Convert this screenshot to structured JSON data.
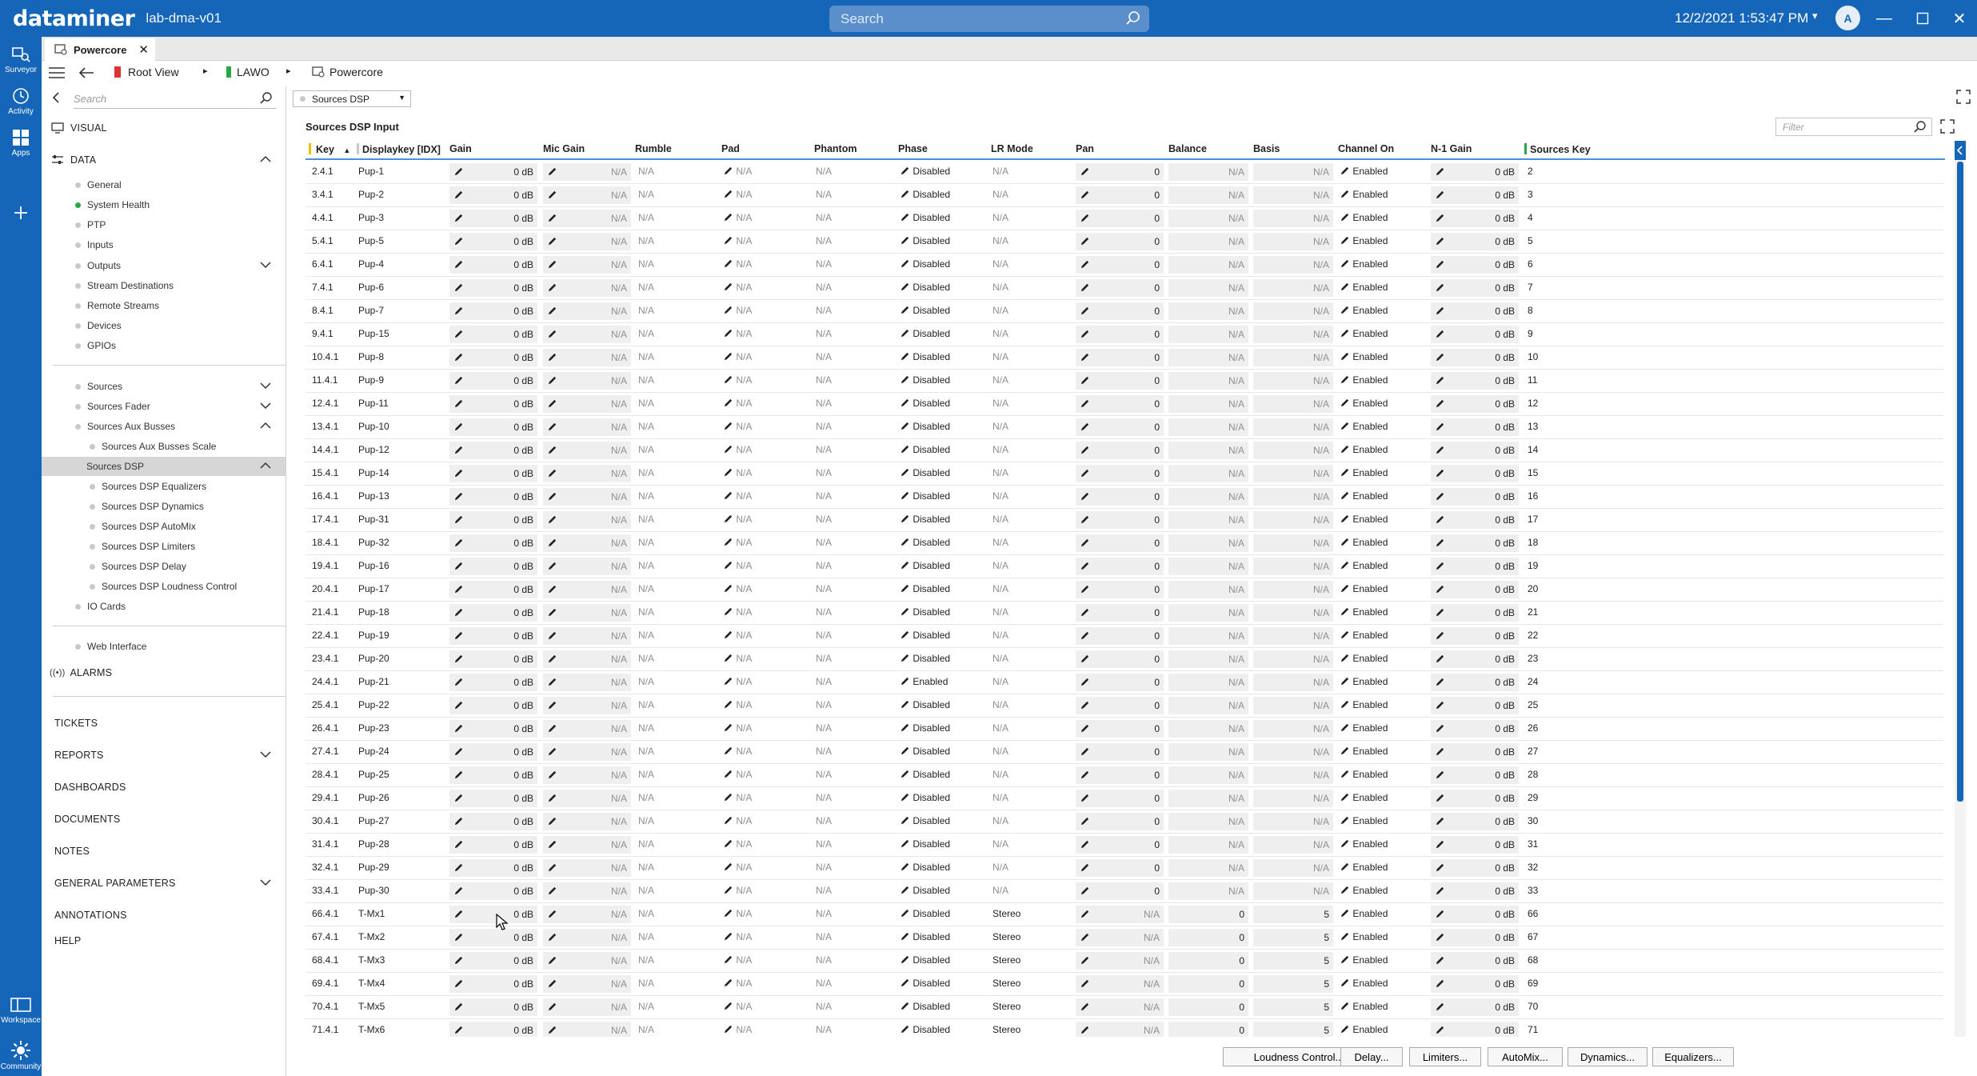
{
  "app": {
    "brand": "dataminer",
    "host": "lab-dma-v01",
    "search_placeholder": "Search",
    "datetime": "12/2/2021 1:53:47 PM",
    "avatar_letter": "A",
    "accent_color": "#1565b8"
  },
  "rail": {
    "surveyor": "Surveyor",
    "activity": "Activity",
    "apps": "Apps",
    "workspace": "Workspace",
    "community": "Community"
  },
  "tab": {
    "label": "Powercore"
  },
  "breadcrumb": {
    "root": "Root View",
    "element": "LAWO",
    "current": "Powercore"
  },
  "sidebar": {
    "search_placeholder": "Search",
    "visual": "VISUAL",
    "data": "DATA",
    "general": "General",
    "system_health": "System Health",
    "ptp": "PTP",
    "inputs": "Inputs",
    "outputs": "Outputs",
    "stream_destinations": "Stream Destinations",
    "remote_streams": "Remote Streams",
    "devices": "Devices",
    "gpios": "GPIOs",
    "sources": "Sources",
    "sources_fader": "Sources Fader",
    "sources_aux_busses": "Sources Aux Busses",
    "sources_aux_busses_scale": "Sources Aux Busses Scale",
    "sources_dsp": "Sources DSP",
    "sources_dsp_equalizers": "Sources DSP Equalizers",
    "sources_dsp_dynamics": "Sources DSP Dynamics",
    "sources_dsp_automix": "Sources DSP AutoMix",
    "sources_dsp_limiters": "Sources DSP Limiters",
    "sources_dsp_delay": "Sources DSP Delay",
    "sources_dsp_loudness": "Sources DSP Loudness Control",
    "io_cards": "IO Cards",
    "web_interface": "Web Interface",
    "alarms": "ALARMS",
    "tickets": "TICKETS",
    "reports": "REPORTS",
    "dashboards": "DASHBOARDS",
    "documents": "DOCUMENTS",
    "notes": "NOTES",
    "general_parameters": "GENERAL PARAMETERS",
    "annotations": "ANNOTATIONS",
    "help": "HELP"
  },
  "main": {
    "dropdown_value": "Sources DSP",
    "table_title": "Sources DSP Input",
    "filter_placeholder": "Filter",
    "columns": [
      "Key",
      "Displaykey [IDX]",
      "Gain",
      "Mic Gain",
      "Rumble",
      "Pad",
      "Phantom",
      "Phase",
      "LR Mode",
      "Pan",
      "Balance",
      "Basis",
      "Channel On",
      "N-1 Gain",
      "Sources Key"
    ],
    "rows": [
      {
        "key": "2.4.1",
        "display": "Pup-1",
        "gain": "0 dB",
        "mic": "N/A",
        "rumble": "N/A",
        "pad": "N/A",
        "phantom": "N/A",
        "phase": "Disabled",
        "lr": "N/A",
        "pan": "0",
        "balance": "N/A",
        "basis": "N/A",
        "channel": "Enabled",
        "n1": "0 dB",
        "skey": "2"
      },
      {
        "key": "3.4.1",
        "display": "Pup-2",
        "gain": "0 dB",
        "mic": "N/A",
        "rumble": "N/A",
        "pad": "N/A",
        "phantom": "N/A",
        "phase": "Disabled",
        "lr": "N/A",
        "pan": "0",
        "balance": "N/A",
        "basis": "N/A",
        "channel": "Enabled",
        "n1": "0 dB",
        "skey": "3"
      },
      {
        "key": "4.4.1",
        "display": "Pup-3",
        "gain": "0 dB",
        "mic": "N/A",
        "rumble": "N/A",
        "pad": "N/A",
        "phantom": "N/A",
        "phase": "Disabled",
        "lr": "N/A",
        "pan": "0",
        "balance": "N/A",
        "basis": "N/A",
        "channel": "Enabled",
        "n1": "0 dB",
        "skey": "4"
      },
      {
        "key": "5.4.1",
        "display": "Pup-5",
        "gain": "0 dB",
        "mic": "N/A",
        "rumble": "N/A",
        "pad": "N/A",
        "phantom": "N/A",
        "phase": "Disabled",
        "lr": "N/A",
        "pan": "0",
        "balance": "N/A",
        "basis": "N/A",
        "channel": "Enabled",
        "n1": "0 dB",
        "skey": "5"
      },
      {
        "key": "6.4.1",
        "display": "Pup-4",
        "gain": "0 dB",
        "mic": "N/A",
        "rumble": "N/A",
        "pad": "N/A",
        "phantom": "N/A",
        "phase": "Disabled",
        "lr": "N/A",
        "pan": "0",
        "balance": "N/A",
        "basis": "N/A",
        "channel": "Enabled",
        "n1": "0 dB",
        "skey": "6"
      },
      {
        "key": "7.4.1",
        "display": "Pup-6",
        "gain": "0 dB",
        "mic": "N/A",
        "rumble": "N/A",
        "pad": "N/A",
        "phantom": "N/A",
        "phase": "Disabled",
        "lr": "N/A",
        "pan": "0",
        "balance": "N/A",
        "basis": "N/A",
        "channel": "Enabled",
        "n1": "0 dB",
        "skey": "7"
      },
      {
        "key": "8.4.1",
        "display": "Pup-7",
        "gain": "0 dB",
        "mic": "N/A",
        "rumble": "N/A",
        "pad": "N/A",
        "phantom": "N/A",
        "phase": "Disabled",
        "lr": "N/A",
        "pan": "0",
        "balance": "N/A",
        "basis": "N/A",
        "channel": "Enabled",
        "n1": "0 dB",
        "skey": "8"
      },
      {
        "key": "9.4.1",
        "display": "Pup-15",
        "gain": "0 dB",
        "mic": "N/A",
        "rumble": "N/A",
        "pad": "N/A",
        "phantom": "N/A",
        "phase": "Disabled",
        "lr": "N/A",
        "pan": "0",
        "balance": "N/A",
        "basis": "N/A",
        "channel": "Enabled",
        "n1": "0 dB",
        "skey": "9"
      },
      {
        "key": "10.4.1",
        "display": "Pup-8",
        "gain": "0 dB",
        "mic": "N/A",
        "rumble": "N/A",
        "pad": "N/A",
        "phantom": "N/A",
        "phase": "Disabled",
        "lr": "N/A",
        "pan": "0",
        "balance": "N/A",
        "basis": "N/A",
        "channel": "Enabled",
        "n1": "0 dB",
        "skey": "10"
      },
      {
        "key": "11.4.1",
        "display": "Pup-9",
        "gain": "0 dB",
        "mic": "N/A",
        "rumble": "N/A",
        "pad": "N/A",
        "phantom": "N/A",
        "phase": "Disabled",
        "lr": "N/A",
        "pan": "0",
        "balance": "N/A",
        "basis": "N/A",
        "channel": "Enabled",
        "n1": "0 dB",
        "skey": "11"
      },
      {
        "key": "12.4.1",
        "display": "Pup-11",
        "gain": "0 dB",
        "mic": "N/A",
        "rumble": "N/A",
        "pad": "N/A",
        "phantom": "N/A",
        "phase": "Disabled",
        "lr": "N/A",
        "pan": "0",
        "balance": "N/A",
        "basis": "N/A",
        "channel": "Enabled",
        "n1": "0 dB",
        "skey": "12"
      },
      {
        "key": "13.4.1",
        "display": "Pup-10",
        "gain": "0 dB",
        "mic": "N/A",
        "rumble": "N/A",
        "pad": "N/A",
        "phantom": "N/A",
        "phase": "Disabled",
        "lr": "N/A",
        "pan": "0",
        "balance": "N/A",
        "basis": "N/A",
        "channel": "Enabled",
        "n1": "0 dB",
        "skey": "13"
      },
      {
        "key": "14.4.1",
        "display": "Pup-12",
        "gain": "0 dB",
        "mic": "N/A",
        "rumble": "N/A",
        "pad": "N/A",
        "phantom": "N/A",
        "phase": "Disabled",
        "lr": "N/A",
        "pan": "0",
        "balance": "N/A",
        "basis": "N/A",
        "channel": "Enabled",
        "n1": "0 dB",
        "skey": "14"
      },
      {
        "key": "15.4.1",
        "display": "Pup-14",
        "gain": "0 dB",
        "mic": "N/A",
        "rumble": "N/A",
        "pad": "N/A",
        "phantom": "N/A",
        "phase": "Disabled",
        "lr": "N/A",
        "pan": "0",
        "balance": "N/A",
        "basis": "N/A",
        "channel": "Enabled",
        "n1": "0 dB",
        "skey": "15"
      },
      {
        "key": "16.4.1",
        "display": "Pup-13",
        "gain": "0 dB",
        "mic": "N/A",
        "rumble": "N/A",
        "pad": "N/A",
        "phantom": "N/A",
        "phase": "Disabled",
        "lr": "N/A",
        "pan": "0",
        "balance": "N/A",
        "basis": "N/A",
        "channel": "Enabled",
        "n1": "0 dB",
        "skey": "16"
      },
      {
        "key": "17.4.1",
        "display": "Pup-31",
        "gain": "0 dB",
        "mic": "N/A",
        "rumble": "N/A",
        "pad": "N/A",
        "phantom": "N/A",
        "phase": "Disabled",
        "lr": "N/A",
        "pan": "0",
        "balance": "N/A",
        "basis": "N/A",
        "channel": "Enabled",
        "n1": "0 dB",
        "skey": "17"
      },
      {
        "key": "18.4.1",
        "display": "Pup-32",
        "gain": "0 dB",
        "mic": "N/A",
        "rumble": "N/A",
        "pad": "N/A",
        "phantom": "N/A",
        "phase": "Disabled",
        "lr": "N/A",
        "pan": "0",
        "balance": "N/A",
        "basis": "N/A",
        "channel": "Enabled",
        "n1": "0 dB",
        "skey": "18"
      },
      {
        "key": "19.4.1",
        "display": "Pup-16",
        "gain": "0 dB",
        "mic": "N/A",
        "rumble": "N/A",
        "pad": "N/A",
        "phantom": "N/A",
        "phase": "Disabled",
        "lr": "N/A",
        "pan": "0",
        "balance": "N/A",
        "basis": "N/A",
        "channel": "Enabled",
        "n1": "0 dB",
        "skey": "19"
      },
      {
        "key": "20.4.1",
        "display": "Pup-17",
        "gain": "0 dB",
        "mic": "N/A",
        "rumble": "N/A",
        "pad": "N/A",
        "phantom": "N/A",
        "phase": "Disabled",
        "lr": "N/A",
        "pan": "0",
        "balance": "N/A",
        "basis": "N/A",
        "channel": "Enabled",
        "n1": "0 dB",
        "skey": "20"
      },
      {
        "key": "21.4.1",
        "display": "Pup-18",
        "gain": "0 dB",
        "mic": "N/A",
        "rumble": "N/A",
        "pad": "N/A",
        "phantom": "N/A",
        "phase": "Disabled",
        "lr": "N/A",
        "pan": "0",
        "balance": "N/A",
        "basis": "N/A",
        "channel": "Enabled",
        "n1": "0 dB",
        "skey": "21"
      },
      {
        "key": "22.4.1",
        "display": "Pup-19",
        "gain": "0 dB",
        "mic": "N/A",
        "rumble": "N/A",
        "pad": "N/A",
        "phantom": "N/A",
        "phase": "Disabled",
        "lr": "N/A",
        "pan": "0",
        "balance": "N/A",
        "basis": "N/A",
        "channel": "Enabled",
        "n1": "0 dB",
        "skey": "22"
      },
      {
        "key": "23.4.1",
        "display": "Pup-20",
        "gain": "0 dB",
        "mic": "N/A",
        "rumble": "N/A",
        "pad": "N/A",
        "phantom": "N/A",
        "phase": "Disabled",
        "lr": "N/A",
        "pan": "0",
        "balance": "N/A",
        "basis": "N/A",
        "channel": "Enabled",
        "n1": "0 dB",
        "skey": "23"
      },
      {
        "key": "24.4.1",
        "display": "Pup-21",
        "gain": "0 dB",
        "mic": "N/A",
        "rumble": "N/A",
        "pad": "N/A",
        "phantom": "N/A",
        "phase": "Enabled",
        "lr": "N/A",
        "pan": "0",
        "balance": "N/A",
        "basis": "N/A",
        "channel": "Enabled",
        "n1": "0 dB",
        "skey": "24"
      },
      {
        "key": "25.4.1",
        "display": "Pup-22",
        "gain": "0 dB",
        "mic": "N/A",
        "rumble": "N/A",
        "pad": "N/A",
        "phantom": "N/A",
        "phase": "Disabled",
        "lr": "N/A",
        "pan": "0",
        "balance": "N/A",
        "basis": "N/A",
        "channel": "Enabled",
        "n1": "0 dB",
        "skey": "25"
      },
      {
        "key": "26.4.1",
        "display": "Pup-23",
        "gain": "0 dB",
        "mic": "N/A",
        "rumble": "N/A",
        "pad": "N/A",
        "phantom": "N/A",
        "phase": "Disabled",
        "lr": "N/A",
        "pan": "0",
        "balance": "N/A",
        "basis": "N/A",
        "channel": "Enabled",
        "n1": "0 dB",
        "skey": "26"
      },
      {
        "key": "27.4.1",
        "display": "Pup-24",
        "gain": "0 dB",
        "mic": "N/A",
        "rumble": "N/A",
        "pad": "N/A",
        "phantom": "N/A",
        "phase": "Disabled",
        "lr": "N/A",
        "pan": "0",
        "balance": "N/A",
        "basis": "N/A",
        "channel": "Enabled",
        "n1": "0 dB",
        "skey": "27"
      },
      {
        "key": "28.4.1",
        "display": "Pup-25",
        "gain": "0 dB",
        "mic": "N/A",
        "rumble": "N/A",
        "pad": "N/A",
        "phantom": "N/A",
        "phase": "Disabled",
        "lr": "N/A",
        "pan": "0",
        "balance": "N/A",
        "basis": "N/A",
        "channel": "Enabled",
        "n1": "0 dB",
        "skey": "28"
      },
      {
        "key": "29.4.1",
        "display": "Pup-26",
        "gain": "0 dB",
        "mic": "N/A",
        "rumble": "N/A",
        "pad": "N/A",
        "phantom": "N/A",
        "phase": "Disabled",
        "lr": "N/A",
        "pan": "0",
        "balance": "N/A",
        "basis": "N/A",
        "channel": "Enabled",
        "n1": "0 dB",
        "skey": "29"
      },
      {
        "key": "30.4.1",
        "display": "Pup-27",
        "gain": "0 dB",
        "mic": "N/A",
        "rumble": "N/A",
        "pad": "N/A",
        "phantom": "N/A",
        "phase": "Disabled",
        "lr": "N/A",
        "pan": "0",
        "balance": "N/A",
        "basis": "N/A",
        "channel": "Enabled",
        "n1": "0 dB",
        "skey": "30"
      },
      {
        "key": "31.4.1",
        "display": "Pup-28",
        "gain": "0 dB",
        "mic": "N/A",
        "rumble": "N/A",
        "pad": "N/A",
        "phantom": "N/A",
        "phase": "Disabled",
        "lr": "N/A",
        "pan": "0",
        "balance": "N/A",
        "basis": "N/A",
        "channel": "Enabled",
        "n1": "0 dB",
        "skey": "31"
      },
      {
        "key": "32.4.1",
        "display": "Pup-29",
        "gain": "0 dB",
        "mic": "N/A",
        "rumble": "N/A",
        "pad": "N/A",
        "phantom": "N/A",
        "phase": "Disabled",
        "lr": "N/A",
        "pan": "0",
        "balance": "N/A",
        "basis": "N/A",
        "channel": "Enabled",
        "n1": "0 dB",
        "skey": "32"
      },
      {
        "key": "33.4.1",
        "display": "Pup-30",
        "gain": "0 dB",
        "mic": "N/A",
        "rumble": "N/A",
        "pad": "N/A",
        "phantom": "N/A",
        "phase": "Disabled",
        "lr": "N/A",
        "pan": "0",
        "balance": "N/A",
        "basis": "N/A",
        "channel": "Enabled",
        "n1": "0 dB",
        "skey": "33"
      },
      {
        "key": "66.4.1",
        "display": "T-Mx1",
        "gain": "0 dB",
        "mic": "N/A",
        "rumble": "N/A",
        "pad": "N/A",
        "phantom": "N/A",
        "phase": "Disabled",
        "lr": "Stereo",
        "pan": "N/A",
        "balance": "0",
        "basis": "5",
        "channel": "Enabled",
        "n1": "0 dB",
        "skey": "66"
      },
      {
        "key": "67.4.1",
        "display": "T-Mx2",
        "gain": "0 dB",
        "mic": "N/A",
        "rumble": "N/A",
        "pad": "N/A",
        "phantom": "N/A",
        "phase": "Disabled",
        "lr": "Stereo",
        "pan": "N/A",
        "balance": "0",
        "basis": "5",
        "channel": "Enabled",
        "n1": "0 dB",
        "skey": "67"
      },
      {
        "key": "68.4.1",
        "display": "T-Mx3",
        "gain": "0 dB",
        "mic": "N/A",
        "rumble": "N/A",
        "pad": "N/A",
        "phantom": "N/A",
        "phase": "Disabled",
        "lr": "Stereo",
        "pan": "N/A",
        "balance": "0",
        "basis": "5",
        "channel": "Enabled",
        "n1": "0 dB",
        "skey": "68"
      },
      {
        "key": "69.4.1",
        "display": "T-Mx4",
        "gain": "0 dB",
        "mic": "N/A",
        "rumble": "N/A",
        "pad": "N/A",
        "phantom": "N/A",
        "phase": "Disabled",
        "lr": "Stereo",
        "pan": "N/A",
        "balance": "0",
        "basis": "5",
        "channel": "Enabled",
        "n1": "0 dB",
        "skey": "69"
      },
      {
        "key": "70.4.1",
        "display": "T-Mx5",
        "gain": "0 dB",
        "mic": "N/A",
        "rumble": "N/A",
        "pad": "N/A",
        "phantom": "N/A",
        "phase": "Disabled",
        "lr": "Stereo",
        "pan": "N/A",
        "balance": "0",
        "basis": "5",
        "channel": "Enabled",
        "n1": "0 dB",
        "skey": "70"
      },
      {
        "key": "71.4.1",
        "display": "T-Mx6",
        "gain": "0 dB",
        "mic": "N/A",
        "rumble": "N/A",
        "pad": "N/A",
        "phantom": "N/A",
        "phase": "Disabled",
        "lr": "Stereo",
        "pan": "N/A",
        "balance": "0",
        "basis": "5",
        "channel": "Enabled",
        "n1": "0 dB",
        "skey": "71"
      }
    ],
    "buttons": [
      "Loudness Control...",
      "Delay...",
      "Limiters...",
      "AutoMix...",
      "Dynamics...",
      "Equalizers..."
    ]
  }
}
